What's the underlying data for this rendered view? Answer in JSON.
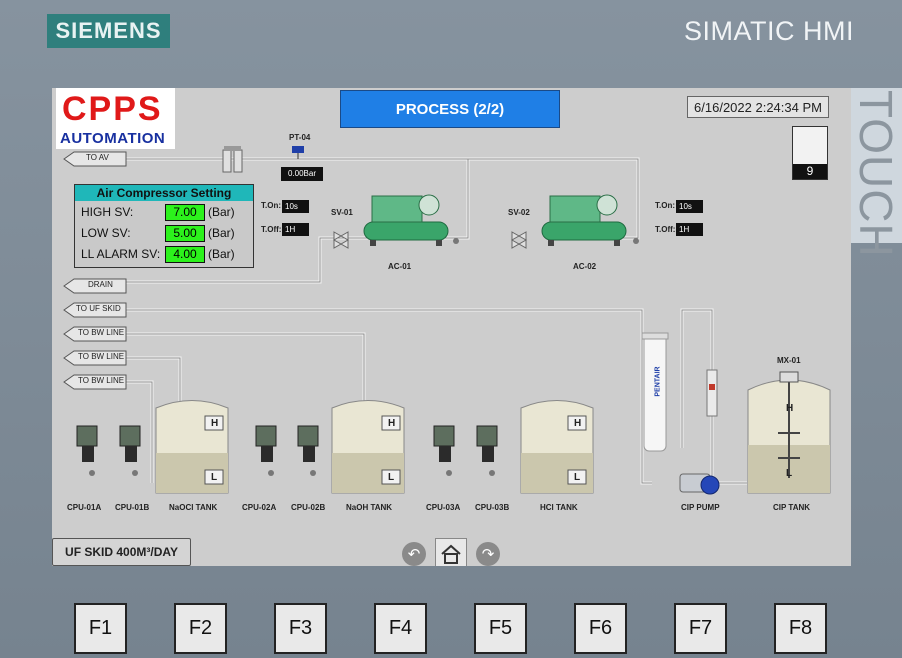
{
  "panel": {
    "brand": "SIEMENS",
    "model": "SIMATIC HMI",
    "touch_label": "TOUCH",
    "fkeys": [
      "F1",
      "F2",
      "F3",
      "F4",
      "F5",
      "F6",
      "F7",
      "F8"
    ]
  },
  "screen": {
    "logo_top": "CPPS",
    "logo_bottom": "AUTOMATION",
    "title": "PROCESS (2/2)",
    "datetime": "6/16/2022 2:24:34 PM",
    "alarm_count": "9",
    "footer_label": "UF SKID 400M³/DAY"
  },
  "lines": {
    "to_av": "TO AV",
    "drain": "DRAIN",
    "to_uf_skid": "TO UF SKID",
    "to_bw_line_1": "TO BW LINE",
    "to_bw_line_2": "TO BW LINE",
    "to_bw_line_3": "TO BW LINE"
  },
  "pressure": {
    "tag": "PT-04",
    "value": "0.00Bar"
  },
  "air_compressor": {
    "title": "Air Compressor Setting",
    "rows": [
      {
        "label": "HIGH SV:",
        "value": "7.00",
        "unit": "(Bar)"
      },
      {
        "label": "LOW SV:",
        "value": "5.00",
        "unit": "(Bar)"
      },
      {
        "label": "LL ALARM SV:",
        "value": "4.00",
        "unit": "(Bar)"
      }
    ]
  },
  "compressors": [
    {
      "tag": "AC-01",
      "valve": "SV-01",
      "t_on_label": "T.On:",
      "t_on": "10s",
      "t_off_label": "T.Off:",
      "t_off": "1H"
    },
    {
      "tag": "AC-02",
      "valve": "SV-02",
      "t_on_label": "T.On:",
      "t_on": "10s",
      "t_off_label": "T.Off:",
      "t_off": "1H"
    }
  ],
  "equipment_labels": {
    "cpu_01a": "CPU-01A",
    "cpu_01b": "CPU-01B",
    "naocl_tank": "NaOCl TANK",
    "cpu_02a": "CPU-02A",
    "cpu_02b": "CPU-02B",
    "naoh_tank": "NaOH TANK",
    "cpu_03a": "CPU-03A",
    "cpu_03b": "CPU-03B",
    "hcl_tank": "HCl TANK",
    "cip_pump": "CIP PUMP",
    "cip_tank": "CIP TANK",
    "mixer": "MX-01",
    "filter_brand": "PENTAIR",
    "level_high": "H",
    "level_low": "L"
  },
  "colors": {
    "title_button": "#1f7fe6",
    "setpoint_field": "#2cf21c",
    "setting_header": "#1fb7b9",
    "brand_box": "#2f7f7d",
    "compressor": "#3aa56a"
  }
}
